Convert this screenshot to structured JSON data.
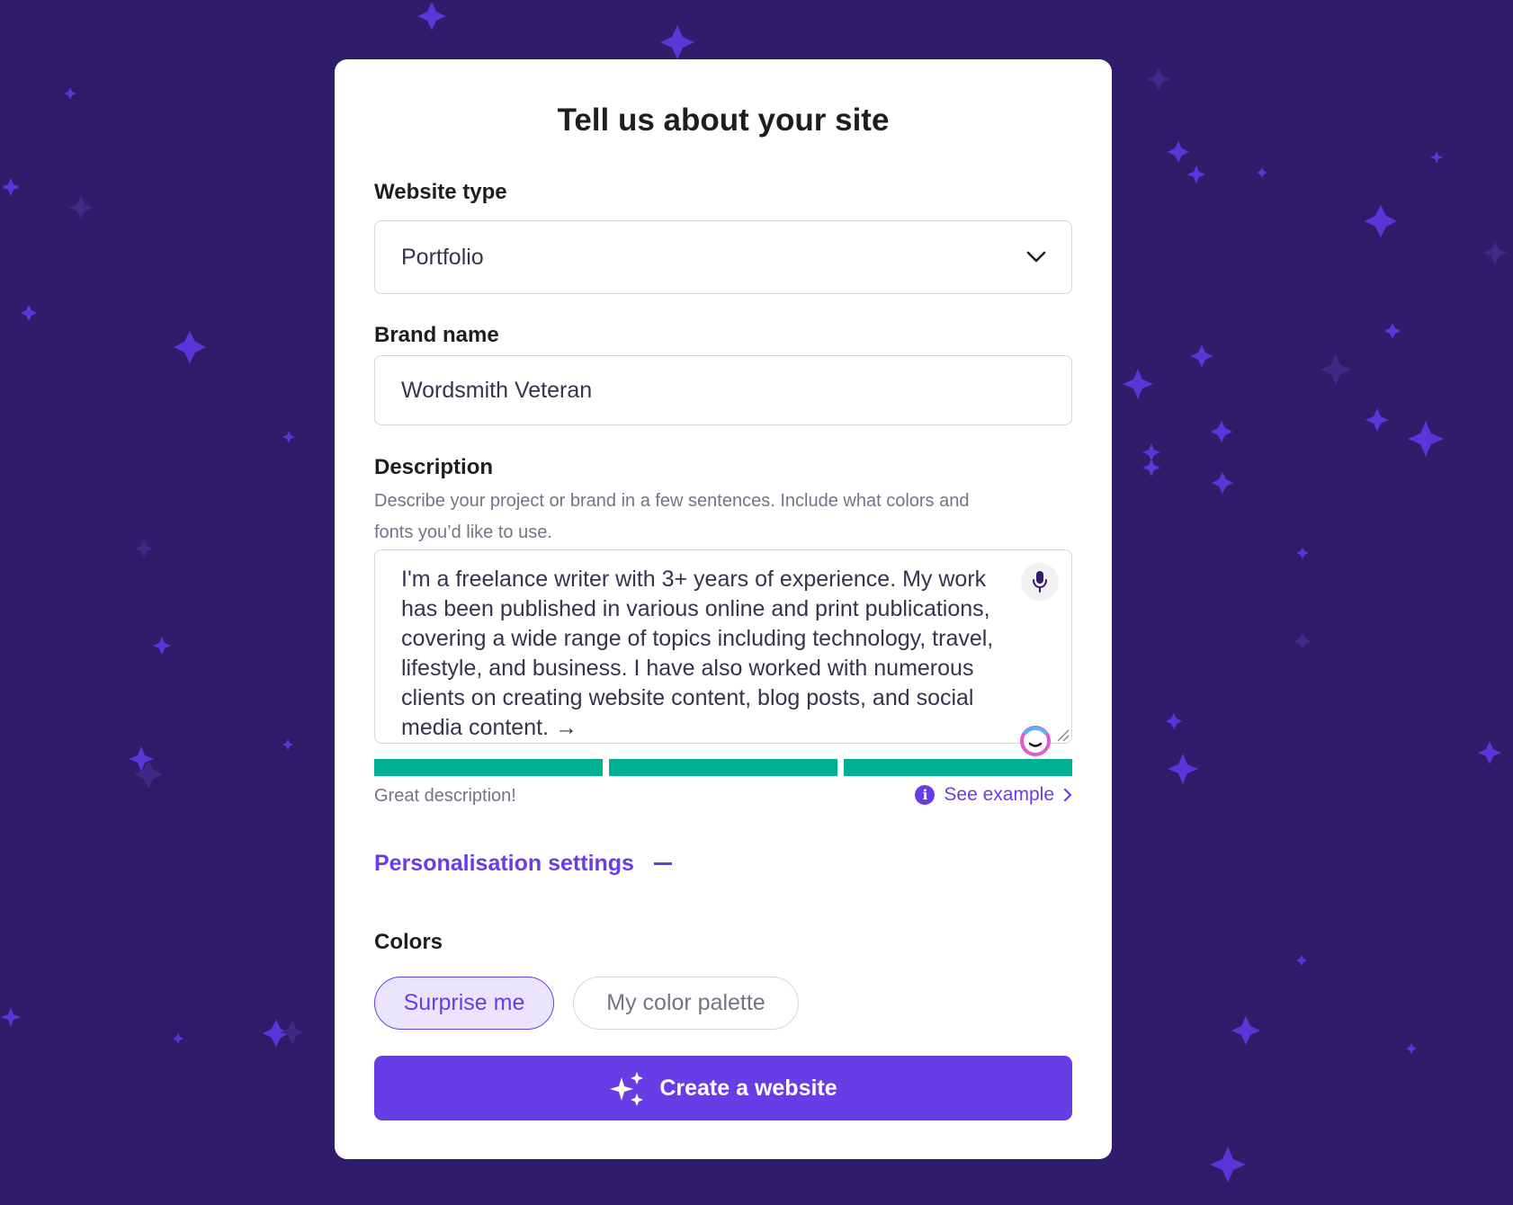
{
  "title": "Tell us about your site",
  "website_type": {
    "label": "Website type",
    "value": "Portfolio",
    "icon": "chevron-down-icon"
  },
  "brand_name": {
    "label": "Brand name",
    "value": "Wordsmith Veteran"
  },
  "description": {
    "label": "Description",
    "help": "Describe your project or brand in a few sentences. Include what colors and fonts you’d like to use.",
    "value": "I'm a freelance writer with 3+ years of experience. My work has been published in various online and print publications, covering a wide range of topics including technology, travel, lifestyle, and business. I have also worked with numerous clients on creating website content, blog posts, and social media content.",
    "arrow": "→",
    "mic_icon": "microphone-icon",
    "quality_segments_filled": 3,
    "quality_segments_total": 3,
    "quality_color": "#00b090",
    "quality_text": "Great description!",
    "see_example": "See example"
  },
  "personalisation": {
    "label": "Personalisation settings"
  },
  "colors": {
    "label": "Colors",
    "options": [
      {
        "label": "Surprise me",
        "selected": true
      },
      {
        "label": "My color palette",
        "selected": false
      }
    ]
  },
  "cta": {
    "label": "Create a website",
    "icon": "sparkles-icon"
  },
  "theme": {
    "background": "#2d1d6b",
    "accent": "#673de6",
    "star": "#5a36d8"
  }
}
